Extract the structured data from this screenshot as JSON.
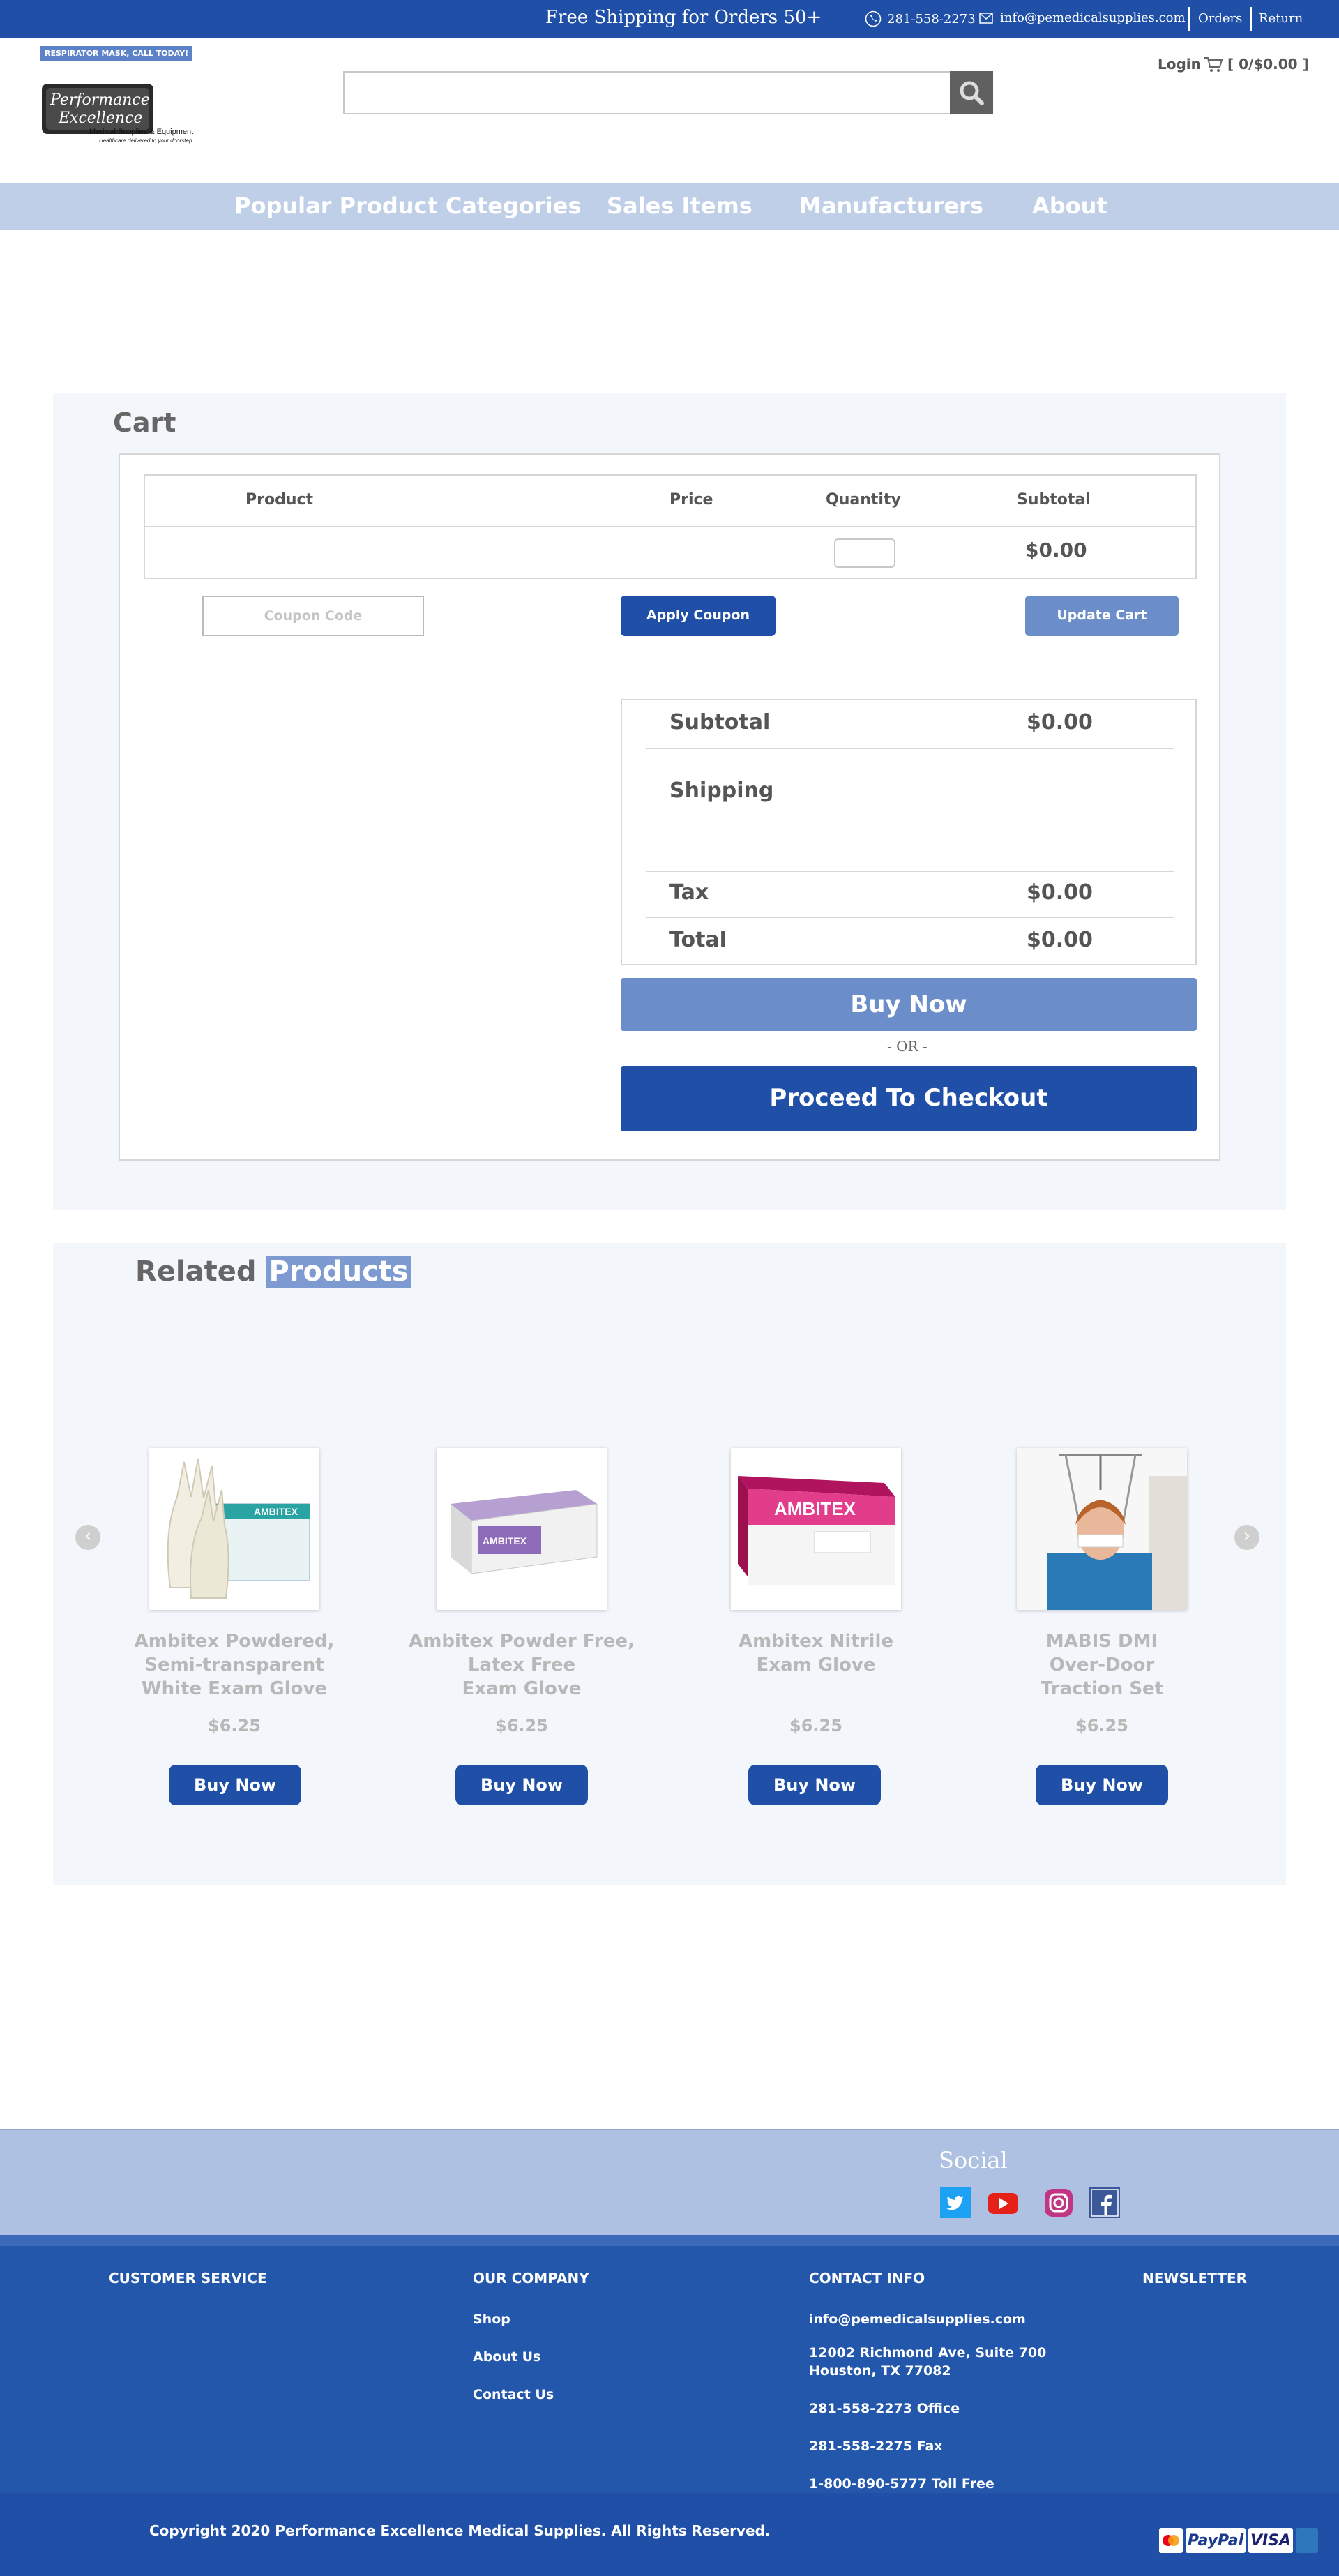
{
  "topbar": {
    "shipping": "Free Shipping for Orders 50+",
    "phone": "281-558-2273",
    "email": "info@pemedicalsupplies.com",
    "orders": "Orders",
    "returns": "Return"
  },
  "header": {
    "promo": "RESPIRATOR MASK, CALL TODAY!",
    "logo_line1": "Performance",
    "logo_line2": "Excellence",
    "logo_line3": "Medical Supplies & Equipment",
    "logo_line4": "Healthcare delivered to your doorstep",
    "search_placeholder": "",
    "login": "Login",
    "cart_summary": "[ 0/$0.00 ]"
  },
  "nav": [
    "Popular Product Categories",
    "Sales Items",
    "Manufacturers",
    "About"
  ],
  "cart": {
    "title": "Cart",
    "columns": [
      "Product",
      "Price",
      "Quantity",
      "Subtotal"
    ],
    "row_subtotal": "$0.00",
    "coupon_placeholder": "Coupon Code",
    "apply_coupon": "Apply Coupon",
    "update_cart": "Update Cart",
    "totals": {
      "subtotal_label": "Subtotal",
      "subtotal_value": "$0.00",
      "shipping_label": "Shipping",
      "tax_label": "Tax",
      "tax_value": "$0.00",
      "total_label": "Total",
      "total_value": "$0.00"
    },
    "buy_now": "Buy Now",
    "or": "- OR -",
    "checkout": "Proceed To Checkout"
  },
  "related": {
    "title_a": "Related",
    "title_b": "Products",
    "products": [
      {
        "name": "Ambitex Powdered,\nSemi-transparent\nWhite Exam Glove",
        "price": "$6.25",
        "button": "Buy Now"
      },
      {
        "name": "Ambitex Powder Free,\nLatex Free\nExam Glove",
        "price": "$6.25",
        "button": "Buy Now"
      },
      {
        "name": "Ambitex Nitrile\nExam Glove",
        "price": "$6.25",
        "button": "Buy Now"
      },
      {
        "name": "MABIS DMI\nOver-Door\nTraction Set",
        "price": "$6.25",
        "button": "Buy Now"
      }
    ],
    "box_brand": "AMBITEX"
  },
  "social": {
    "title": "Social"
  },
  "footer": {
    "customer_service": "CUSTOMER SERVICE",
    "our_company": "OUR COMPANY",
    "company_links": [
      "Shop",
      "About Us",
      "Contact Us"
    ],
    "contact_info": "CONTACT INFO",
    "contact_email": "info@pemedicalsupplies.com",
    "address_1": "12002 Richmond Ave, Suite 700",
    "address_2": "Houston, TX 77082",
    "office": "281-558-2273 Office",
    "fax": "281-558-2275 Fax",
    "toll_free": "1-800-890-5777 Toll Free",
    "newsletter": "NEWSLETTER",
    "copyright": "Copyright 2020 Performance Excellence Medical Supplies. All Rights Reserved.",
    "payments": [
      "PayPal",
      "VISA"
    ]
  },
  "colors": {
    "primary": "#1f4fa6",
    "light_button": "#6b8dc9",
    "nav_bg": "#c0cfe8",
    "section_bg": "#f3f6fb"
  }
}
